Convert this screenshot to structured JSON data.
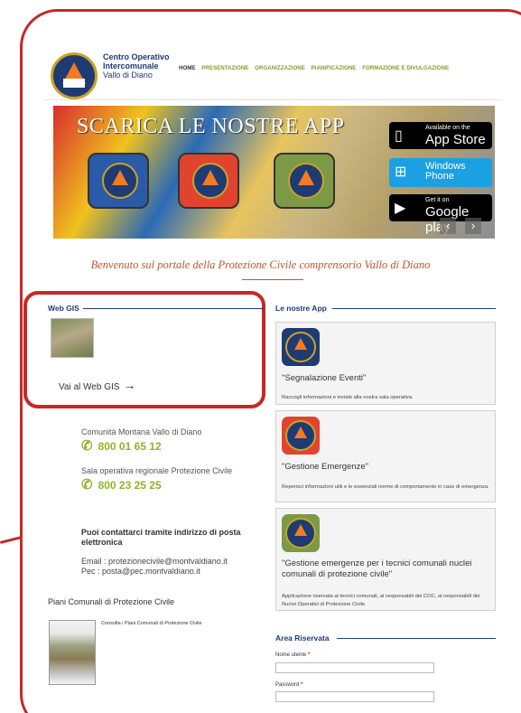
{
  "header": {
    "brand_line1": "Centro Operativo",
    "brand_line2": "Intercomunale",
    "brand_line3": "Vallo di Diano",
    "nav": [
      "HOME",
      "PRESENTAZIONE",
      "ORGANIZZAZIONE",
      "PIANIFICAZIONE",
      "FORMAZIONE E DIVULGAZIONE"
    ]
  },
  "banner": {
    "title": "SCARICA LE NOSTRE APP",
    "stores": [
      {
        "small": "Available on the",
        "large": "App Store",
        "icon": "apple-icon"
      },
      {
        "small": "",
        "large": "Windows Phone",
        "icon": "windows-icon"
      },
      {
        "small": "Get it on",
        "large": "Google play",
        "icon": "google-play-icon"
      }
    ],
    "prev": "‹",
    "next": "›"
  },
  "welcome": "Benvenuto sul portale della Protezione Civile comprensorio Vallo di Diano",
  "webgis": {
    "title": "Web GIS",
    "link": "Vai al Web GIS",
    "arrow": "→"
  },
  "contacts": {
    "org1": "Comunità Montana Vallo di Diano",
    "phone1": "800 01 65 12",
    "org2": "Sala operativa regionale Protezione Civile",
    "phone2": "800 23 25 25",
    "email_title": "Puoi contattarci tramite indirizzo di posta elettronica",
    "email": "Email : protezionecivile@montvaldiano.it",
    "pec": "Pec : posta@pec.montvaldiano.it"
  },
  "piani": {
    "title": "Piani Comunali di Protezione Civile",
    "link": "Consulta i Piani Comunali di Protezione Civile"
  },
  "apps": {
    "title": "Le nostre App",
    "items": [
      {
        "name": "\"Segnalazione Eventi\"",
        "desc": "Raccogli informazioni e inviale alla nostra sala operativa.",
        "color": "#1f3b73"
      },
      {
        "name": "\"Gestione Emergenze\"",
        "desc": "Reperisci informazioni utili e le essenziali norme di comportamento in caso di emergenza.",
        "color": "#e0442f"
      },
      {
        "name": "\"Gestione emergenze per i tecnici comunali nuclei comunali di protezione civile\"",
        "desc": "Applicazione riservata ai tecnici comunali, ai responsabili dei COC, ai responsabili dei Nuclei Operativi di Protezione Civile",
        "color": "#7c9a45"
      }
    ]
  },
  "login": {
    "title": "Area Riservata",
    "user_label": "Nome utente",
    "pass_label": "Password",
    "required": "*"
  }
}
